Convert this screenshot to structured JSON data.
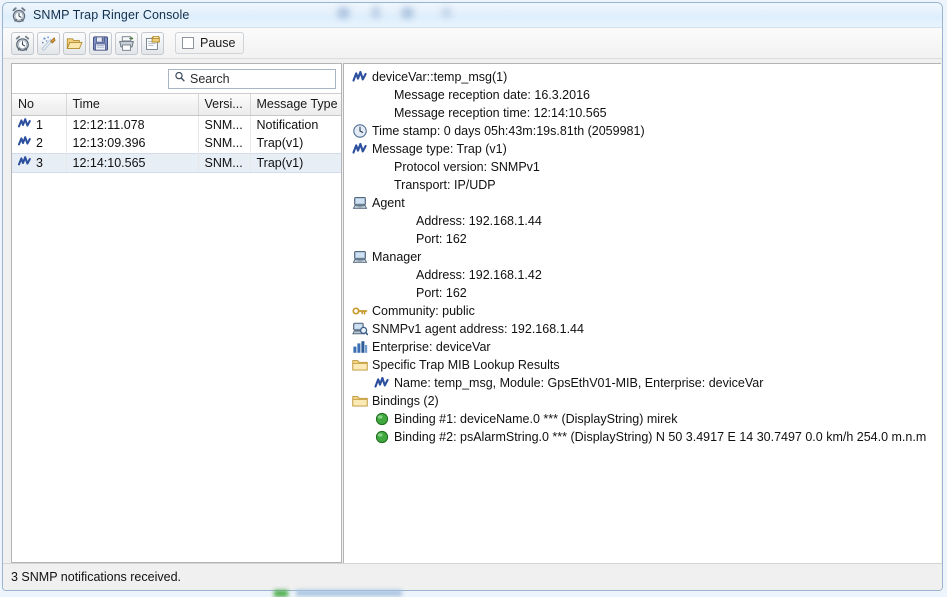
{
  "window": {
    "title": "SNMP Trap Ringer Console",
    "title_icon": "alarm-clock-icon"
  },
  "toolbar": {
    "buttons": [
      {
        "name": "new-session-button",
        "icon": "alarm-clock-icon",
        "tooltip": "New"
      },
      {
        "name": "clear-button",
        "icon": "magic-wand-icon",
        "tooltip": "Clear"
      },
      {
        "name": "open-button",
        "icon": "open-folder-icon",
        "tooltip": "Open"
      },
      {
        "name": "save-button",
        "icon": "floppy-disk-icon",
        "tooltip": "Save"
      },
      {
        "name": "print-button",
        "icon": "printer-icon",
        "tooltip": "Print"
      },
      {
        "name": "export-button",
        "icon": "folder-export-icon",
        "tooltip": "Export"
      }
    ],
    "pause_label": "Pause",
    "pause_checked": false
  },
  "search": {
    "placeholder": "Search",
    "value": "",
    "icon": "search-icon"
  },
  "table": {
    "columns": [
      "No",
      "Time",
      "Versi...",
      "Message Type"
    ],
    "rows": [
      {
        "icon": "trap-message-icon",
        "no": "1",
        "time": "12:12:11.078",
        "version": "SNM...",
        "type": "Notification",
        "selected": false
      },
      {
        "icon": "trap-message-icon",
        "no": "2",
        "time": "12:13:09.396",
        "version": "SNM...",
        "type": "Trap(v1)",
        "selected": false
      },
      {
        "icon": "trap-message-icon",
        "no": "3",
        "time": "12:14:10.565",
        "version": "SNM...",
        "type": "Trap(v1)",
        "selected": true
      }
    ]
  },
  "scrollbar": {
    "left_arrow": "◀",
    "right_arrow": "▶",
    "grip": "∣∣∣"
  },
  "tree": {
    "nodes": [
      {
        "indent": 0,
        "icon": "trap-message-icon",
        "label": "deviceVar::temp_msg(1)"
      },
      {
        "indent": 1,
        "icon": "none",
        "label": "Message reception date: 16.3.2016"
      },
      {
        "indent": 1,
        "icon": "none",
        "label": "Message reception time: 12:14:10.565"
      },
      {
        "indent": 0,
        "icon": "clock-icon",
        "label": "Time stamp: 0 days 05h:43m:19s.81th (2059981)"
      },
      {
        "indent": 0,
        "icon": "trap-message-icon",
        "label": "Message type: Trap (v1)"
      },
      {
        "indent": 1,
        "icon": "none",
        "label": "Protocol version: SNMPv1"
      },
      {
        "indent": 1,
        "icon": "none",
        "label": "Transport: IP/UDP"
      },
      {
        "indent": 0,
        "icon": "computer-icon",
        "label": "Agent"
      },
      {
        "indent": 2,
        "icon": "none",
        "label": "Address: 192.168.1.44"
      },
      {
        "indent": 2,
        "icon": "none",
        "label": "Port: 162"
      },
      {
        "indent": 0,
        "icon": "computer-icon",
        "label": "Manager"
      },
      {
        "indent": 2,
        "icon": "none",
        "label": "Address: 192.168.1.42"
      },
      {
        "indent": 2,
        "icon": "none",
        "label": "Port: 162"
      },
      {
        "indent": 0,
        "icon": "key-icon",
        "label": "Community: public"
      },
      {
        "indent": 0,
        "icon": "computer-search-icon",
        "label": "SNMPv1 agent address: 192.168.1.44"
      },
      {
        "indent": 0,
        "icon": "bar-chart-icon",
        "label": "Enterprise: deviceVar"
      },
      {
        "indent": 0,
        "icon": "folder-icon",
        "label": "Specific Trap MIB Lookup Results"
      },
      {
        "indent": 1,
        "icon": "trap-message-icon",
        "label": "Name: temp_msg, Module: GpsEthV01-MIB, Enterprise: deviceVar"
      },
      {
        "indent": 0,
        "icon": "folder-icon",
        "label": "Bindings (2)"
      },
      {
        "indent": 1,
        "icon": "green-sphere-icon",
        "label": "Binding #1: deviceName.0 *** (DisplayString) mirek"
      },
      {
        "indent": 1,
        "icon": "green-sphere-icon",
        "label": "Binding #2: psAlarmString.0 *** (DisplayString) N 50 3.4917  E 14 30.7497  0.0 km/h 254.0 m.n.m"
      }
    ]
  },
  "status": {
    "text": "3 SNMP notifications received."
  },
  "colors": {
    "accent": "#3a63a8",
    "title_bar": "#e4f0fb",
    "selection": "#e8eef6",
    "folder": "#f0c674",
    "binding_green": "#35a235"
  }
}
